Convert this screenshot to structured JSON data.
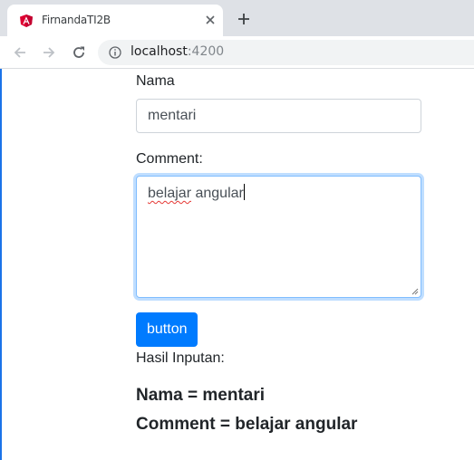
{
  "browser": {
    "tab_title": "FirnandaTI2B",
    "url_host": "localhost",
    "url_port": ":4200",
    "favicon": "angular-icon",
    "accent": "#dd0031"
  },
  "form": {
    "nama_label": "Nama",
    "nama_value": "mentari",
    "comment_label": "Comment:",
    "comment_word1": "belajar",
    "comment_rest": " angular",
    "button_label": "button",
    "button_color": "#007bff"
  },
  "output": {
    "heading": "Hasil Inputan:",
    "nama_line": "Nama = mentari",
    "comment_line": "Comment = belajar angular"
  }
}
